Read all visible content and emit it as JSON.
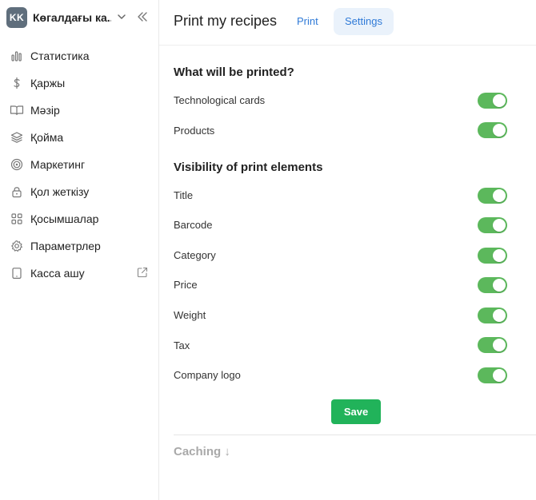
{
  "account": {
    "initials": "KK",
    "name": "Көгалдағы ка..."
  },
  "sidebar": {
    "items": [
      {
        "label": "Статистика",
        "icon": "bar-chart-icon"
      },
      {
        "label": "Қаржы",
        "icon": "dollar-icon"
      },
      {
        "label": "Мәзір",
        "icon": "book-icon"
      },
      {
        "label": "Қойма",
        "icon": "layers-icon"
      },
      {
        "label": "Маркетинг",
        "icon": "target-icon"
      },
      {
        "label": "Қол жеткізу",
        "icon": "lock-icon"
      },
      {
        "label": "Қосымшалар",
        "icon": "apps-grid-icon"
      },
      {
        "label": "Параметрлер",
        "icon": "gear-icon"
      },
      {
        "label": "Касса ашу",
        "icon": "tablet-icon"
      }
    ]
  },
  "header": {
    "title": "Print my recipes",
    "tabs": [
      {
        "label": "Print",
        "active": false
      },
      {
        "label": "Settings",
        "active": true
      }
    ]
  },
  "settings": {
    "section1": {
      "title": "What will be printed?",
      "rows": [
        {
          "label": "Technological cards",
          "on": true
        },
        {
          "label": "Products",
          "on": true
        }
      ]
    },
    "section2": {
      "title": "Visibility of print elements",
      "rows": [
        {
          "label": "Title",
          "on": true
        },
        {
          "label": "Barcode",
          "on": true
        },
        {
          "label": "Category",
          "on": true
        },
        {
          "label": "Price",
          "on": true
        },
        {
          "label": "Weight",
          "on": true
        },
        {
          "label": "Tax",
          "on": true
        },
        {
          "label": "Company logo",
          "on": true
        }
      ]
    },
    "save_label": "Save",
    "caching_label": "Caching ↓"
  },
  "colors": {
    "accent": "#2f7ad7",
    "toggle_on": "#5cb85c",
    "save": "#21b35a",
    "avatar": "#5f6e7c"
  }
}
